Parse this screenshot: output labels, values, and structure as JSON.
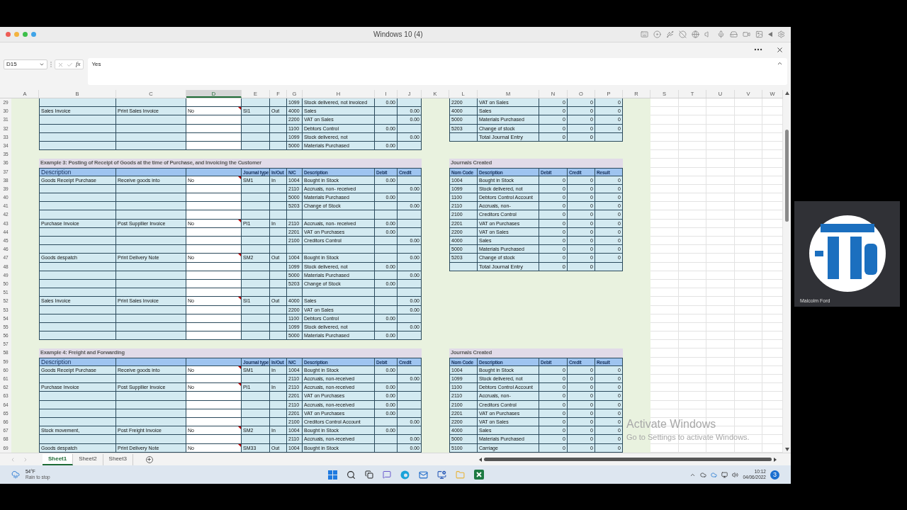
{
  "window": {
    "title": "Windows 10 (4)"
  },
  "formula_bar": {
    "name_box": "D15",
    "fx": "fx",
    "formula": "Yes"
  },
  "columns": [
    {
      "label": "A",
      "selected": false
    },
    {
      "label": "B",
      "selected": false
    },
    {
      "label": "C",
      "selected": false
    },
    {
      "label": "D",
      "selected": true
    },
    {
      "label": "E",
      "selected": false
    },
    {
      "label": "F",
      "selected": false
    },
    {
      "label": "G",
      "selected": false
    },
    {
      "label": "H",
      "selected": false
    },
    {
      "label": "I",
      "selected": false
    },
    {
      "label": "J",
      "selected": false
    },
    {
      "label": "K",
      "selected": false
    },
    {
      "label": "L",
      "selected": false
    },
    {
      "label": "M",
      "selected": false
    },
    {
      "label": "N",
      "selected": false
    },
    {
      "label": "O",
      "selected": false
    },
    {
      "label": "P",
      "selected": false
    },
    {
      "label": "R",
      "selected": false
    },
    {
      "label": "S",
      "selected": false
    },
    {
      "label": "T",
      "selected": false
    },
    {
      "label": "U",
      "selected": false
    },
    {
      "label": "V",
      "selected": false
    },
    {
      "label": "W",
      "selected": false
    }
  ],
  "rows": [
    {
      "number": "29",
      "left": {
        "kind": "row",
        "nc": "1099",
        "account": "Stock delivered, not invoiced",
        "debit": "0.00"
      },
      "right": {
        "kind": "row",
        "code": "2200",
        "account": "VAT on Sales",
        "debit": "0",
        "credit": "0",
        "result": "0"
      }
    },
    {
      "number": "30",
      "left": {
        "kind": "row",
        "description": "Sales Invoice",
        "action": "Print Sales Invoice",
        "posted": "No",
        "note": true,
        "journal": "SI1",
        "in_out": "Out",
        "nc": "4000",
        "account": "Sales",
        "credit": "0.00"
      },
      "right": {
        "kind": "row",
        "code": "4000",
        "account": "Sales",
        "debit": "0",
        "credit": "0",
        "result": "0"
      }
    },
    {
      "number": "31",
      "left": {
        "kind": "row",
        "nc": "2200",
        "account": "VAT on Sales",
        "credit": "0.00"
      },
      "right": {
        "kind": "row",
        "code": "5000",
        "account": "Materials Purchased",
        "debit": "0",
        "credit": "0",
        "result": "0"
      }
    },
    {
      "number": "32",
      "left": {
        "kind": "row",
        "nc": "1100",
        "account": "Debtors Control",
        "debit": "0.00"
      },
      "right": {
        "kind": "row",
        "code": "5203",
        "account": "Change of stock",
        "debit": "0",
        "credit": "0",
        "result": "0"
      }
    },
    {
      "number": "33",
      "left": {
        "kind": "row",
        "nc": "1099",
        "account": "Stock delivered, not",
        "credit": "0.00"
      },
      "right": {
        "kind": "total",
        "account": "Total Journal Entry",
        "debit": "0",
        "credit": "0"
      }
    },
    {
      "number": "34",
      "left": {
        "kind": "row",
        "nc": "5000",
        "account": "Materials Purchased",
        "debit": "0.00"
      },
      "right": {
        "kind": "spacer"
      }
    },
    {
      "number": "35",
      "left": {
        "kind": "spacer"
      },
      "right": {
        "kind": "spacer"
      }
    },
    {
      "number": "36",
      "left": {
        "kind": "title",
        "text": "Example 3: Posting of Receipt of Goods at the time of Purchase, and Invoicing the Customer"
      },
      "right": {
        "kind": "title",
        "text": "Journals Created"
      }
    },
    {
      "number": "37",
      "left": {
        "kind": "header",
        "description": "Description",
        "journal": "Journal type",
        "in_out": "In/Out",
        "nc": "N/C",
        "account": "Description",
        "debit": "Debit",
        "credit": "Credit"
      },
      "right": {
        "kind": "header",
        "code": "Nom Code",
        "account": "Description",
        "debit": "Debit",
        "credit": "Credit",
        "result": "Result"
      }
    },
    {
      "number": "38",
      "left": {
        "kind": "row",
        "description": "Goods Receipt Purchase",
        "action": "Receive goods into",
        "posted": "No",
        "note": true,
        "journal": "SM1",
        "in_out": "In",
        "nc": "1004",
        "account": "Bought in Stock",
        "debit": "0.00"
      },
      "right": {
        "kind": "row",
        "code": "1004",
        "account": "Bought in Stock",
        "debit": "0",
        "credit": "0",
        "result": "0"
      }
    },
    {
      "number": "39",
      "left": {
        "kind": "row",
        "nc": "2110",
        "account": "Accruals, non- received",
        "credit": "0.00"
      },
      "right": {
        "kind": "row",
        "code": "1099",
        "account": "Stock delivered, not",
        "debit": "0",
        "credit": "0",
        "result": "0"
      }
    },
    {
      "number": "40",
      "left": {
        "kind": "row",
        "nc": "5000",
        "account": "Materials Purchased",
        "debit": "0.00"
      },
      "right": {
        "kind": "row",
        "code": "1100",
        "account": "Debtors Control Account",
        "debit": "0",
        "credit": "0",
        "result": "0"
      }
    },
    {
      "number": "41",
      "left": {
        "kind": "row",
        "nc": "5203",
        "account": "Change of Stock",
        "credit": "0.00"
      },
      "right": {
        "kind": "row",
        "code": "2110",
        "account": "Accruals, non-",
        "debit": "0",
        "credit": "0",
        "result": "0"
      }
    },
    {
      "number": "42",
      "left": {
        "kind": "row"
      },
      "right": {
        "kind": "row",
        "code": "2100",
        "account": "Creditors Control",
        "debit": "0",
        "credit": "0",
        "result": "0"
      }
    },
    {
      "number": "43",
      "left": {
        "kind": "row",
        "description": "Purchase Invoice",
        "action": "Post Suppllier Invoice",
        "posted": "No",
        "note": true,
        "journal": "PI1",
        "in_out": "In",
        "nc": "2110",
        "account": "Accruals, non- received",
        "debit": "0.00"
      },
      "right": {
        "kind": "row",
        "code": "2201",
        "account": "VAT on Purchases",
        "debit": "0",
        "credit": "0",
        "result": "0"
      }
    },
    {
      "number": "44",
      "left": {
        "kind": "row",
        "nc": "2201",
        "account": "VAT on Purchases",
        "debit": "0.00"
      },
      "right": {
        "kind": "row",
        "code": "2200",
        "account": "VAT on Sales",
        "debit": "0",
        "credit": "0",
        "result": "0"
      }
    },
    {
      "number": "45",
      "left": {
        "kind": "row",
        "nc": "2100",
        "account": "Creditors Control",
        "credit": "0.00"
      },
      "right": {
        "kind": "row",
        "code": "4000",
        "account": "Sales",
        "debit": "0",
        "credit": "0",
        "result": "0"
      }
    },
    {
      "number": "46",
      "left": {
        "kind": "row"
      },
      "right": {
        "kind": "row",
        "code": "5000",
        "account": "Materials Purchased",
        "debit": "0",
        "credit": "0",
        "result": "0"
      }
    },
    {
      "number": "47",
      "left": {
        "kind": "row",
        "description": "Goods despatch",
        "action": "Print Delivery Note",
        "posted": "No",
        "note": true,
        "journal": "SM2",
        "in_out": "Out",
        "nc": "1004",
        "account": "Bought in Stock",
        "credit": "0.00"
      },
      "right": {
        "kind": "row",
        "code": "5203",
        "account": "Change of stock",
        "debit": "0",
        "credit": "0",
        "result": "0"
      }
    },
    {
      "number": "48",
      "left": {
        "kind": "row",
        "nc": "1099",
        "account": "Stock delivered, not",
        "debit": "0.00"
      },
      "right": {
        "kind": "total",
        "account": "Total Journal Entry",
        "debit": "0",
        "credit": "0"
      }
    },
    {
      "number": "49",
      "left": {
        "kind": "row",
        "nc": "5000",
        "account": "Materials Purchased",
        "credit": "0.00"
      },
      "right": {
        "kind": "spacer"
      }
    },
    {
      "number": "50",
      "left": {
        "kind": "row",
        "nc": "5203",
        "account": "Change of Stock",
        "debit": "0.00"
      },
      "right": {
        "kind": "spacer"
      }
    },
    {
      "number": "51",
      "left": {
        "kind": "row"
      },
      "right": {
        "kind": "spacer"
      }
    },
    {
      "number": "52",
      "left": {
        "kind": "row",
        "description": "Sales Invoice",
        "action": "Print Sales Invoice",
        "posted": "No",
        "note": true,
        "journal": "SI1",
        "in_out": "Out",
        "nc": "4000",
        "account": "Sales",
        "credit": "0.00"
      },
      "right": {
        "kind": "spacer"
      }
    },
    {
      "number": "53",
      "left": {
        "kind": "row",
        "nc": "2200",
        "account": "VAT on Sales",
        "credit": "0.00"
      },
      "right": {
        "kind": "spacer"
      }
    },
    {
      "number": "54",
      "left": {
        "kind": "row",
        "nc": "1100",
        "account": "Debtors Control",
        "debit": "0.00"
      },
      "right": {
        "kind": "spacer"
      }
    },
    {
      "number": "55",
      "left": {
        "kind": "row",
        "nc": "1099",
        "account": "Stock delivered, not",
        "credit": "0.00"
      },
      "right": {
        "kind": "spacer"
      }
    },
    {
      "number": "56",
      "left": {
        "kind": "row",
        "nc": "5000",
        "account": "Materials Purchased",
        "debit": "0.00"
      },
      "right": {
        "kind": "spacer"
      }
    },
    {
      "number": "57",
      "left": {
        "kind": "spacer"
      },
      "right": {
        "kind": "spacer"
      }
    },
    {
      "number": "58",
      "left": {
        "kind": "title",
        "text": "Example 4: Freight and Forwarding"
      },
      "right": {
        "kind": "title",
        "text": "Journals Created"
      }
    },
    {
      "number": "59",
      "left": {
        "kind": "header",
        "description": "Description",
        "journal": "Journal type",
        "in_out": "In/Out",
        "nc": "N/C",
        "account": "Description",
        "debit": "Debit",
        "credit": "Credit"
      },
      "right": {
        "kind": "header",
        "code": "Nom Code",
        "account": "Description",
        "debit": "Debit",
        "credit": "Credit",
        "result": "Result"
      }
    },
    {
      "number": "60",
      "left": {
        "kind": "row",
        "description": "Goods Receipt Purchase",
        "action": "Receive goods into",
        "posted": "No",
        "note": true,
        "journal": "SM1",
        "in_out": "In",
        "nc": "1004",
        "account": "Bought in Stock",
        "debit": "0.00"
      },
      "right": {
        "kind": "row",
        "code": "1004",
        "account": "Bought in Stock",
        "debit": "0",
        "credit": "0",
        "result": "0"
      }
    },
    {
      "number": "61",
      "left": {
        "kind": "row",
        "nc": "2110",
        "account": "Accruals, non-received",
        "credit": "0.00"
      },
      "right": {
        "kind": "row",
        "code": "1099",
        "account": "Stock delivered, not",
        "debit": "0",
        "credit": "0",
        "result": "0"
      }
    },
    {
      "number": "62",
      "left": {
        "kind": "row",
        "description": "Purchase Invoice",
        "action": "Post Suppllier Invoice",
        "posted": "No",
        "note": true,
        "journal": "PI1",
        "in_out": "In",
        "nc": "2110",
        "account": "Accruals, non-received",
        "debit": "0.00"
      },
      "right": {
        "kind": "row",
        "code": "1100",
        "account": "Debtors Control Account",
        "debit": "0",
        "credit": "0",
        "result": "0"
      }
    },
    {
      "number": "63",
      "left": {
        "kind": "row",
        "nc": "2201",
        "account": "VAT on Purchases",
        "debit": "0.00"
      },
      "right": {
        "kind": "row",
        "code": "2110",
        "account": "Accruals, non-",
        "debit": "0",
        "credit": "0",
        "result": "0"
      }
    },
    {
      "number": "64",
      "left": {
        "kind": "row",
        "nc": "2110",
        "account": "Accruals, non-received",
        "debit": "0.00"
      },
      "right": {
        "kind": "row",
        "code": "2100",
        "account": "Creditors Control",
        "debit": "0",
        "credit": "0",
        "result": "0"
      }
    },
    {
      "number": "65",
      "left": {
        "kind": "row",
        "nc": "2201",
        "account": "VAT on Purchases",
        "debit": "0.00"
      },
      "right": {
        "kind": "row",
        "code": "2201",
        "account": "VAT on Purchases",
        "debit": "0",
        "credit": "0",
        "result": "0"
      }
    },
    {
      "number": "66",
      "left": {
        "kind": "row",
        "nc": "2100",
        "account": "Creditors Control Account",
        "credit": "0.00"
      },
      "right": {
        "kind": "row",
        "code": "2200",
        "account": "VAT on Sales",
        "debit": "0",
        "credit": "0",
        "result": "0"
      }
    },
    {
      "number": "67",
      "left": {
        "kind": "row",
        "description": "Stock movement,",
        "action": "Post Freight Invoice",
        "posted": "No",
        "note": true,
        "journal": "SM2",
        "in_out": "In",
        "nc": "1004",
        "account": "Bought in Stock",
        "debit": "0.00"
      },
      "right": {
        "kind": "row",
        "code": "4000",
        "account": "Sales",
        "debit": "0",
        "credit": "0",
        "result": "0"
      }
    },
    {
      "number": "68",
      "left": {
        "kind": "row",
        "nc": "2110",
        "account": "Accruals, non-received",
        "credit": "0.00"
      },
      "right": {
        "kind": "row",
        "code": "5000",
        "account": "Materials Purchased",
        "debit": "0",
        "credit": "0",
        "result": "0"
      }
    },
    {
      "number": "69",
      "left": {
        "kind": "row",
        "description": "Goods despatch",
        "action": "Print Delivery Note",
        "posted": "No",
        "note": true,
        "journal": "SM33",
        "in_out": "Out",
        "nc": "1004",
        "account": "Bought in Stock",
        "credit": "0.00"
      },
      "right": {
        "kind": "row",
        "code": "5100",
        "account": "Carriage",
        "debit": "0",
        "credit": "0",
        "result": "0"
      }
    }
  ],
  "sheets": [
    {
      "name": "Sheet1",
      "selected": true
    },
    {
      "name": "Sheet2",
      "selected": false
    },
    {
      "name": "Sheet3",
      "selected": false
    }
  ],
  "activation": {
    "title": "Activate Windows",
    "text": "Go to Settings to activate Windows."
  },
  "taskbar": {
    "temperature": "54°F",
    "weather": "Rain to stop",
    "time": "10:12",
    "date": "04/06/2022",
    "badge": "3"
  },
  "video": {
    "participant": "Malcolm Ford"
  }
}
